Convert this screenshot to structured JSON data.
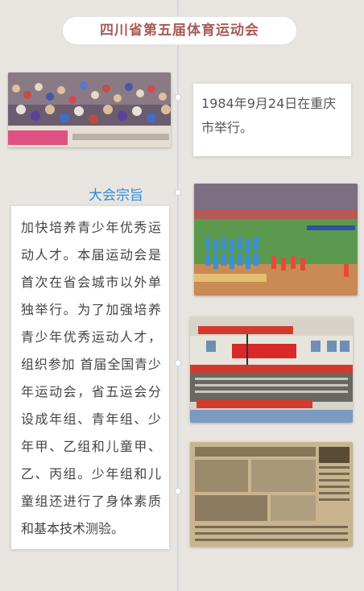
{
  "header": {
    "title": "四川省第五届体育运动会"
  },
  "timeline": {
    "date_text": "1984年9月24日在重庆市举行。",
    "section_heading": "大会宗旨",
    "description": "加快培养青少年优秀运动人才。本届运动会是首次在省会城市以外单独举行。为了加强培养青少年优秀运动人才，组织参加 首届全国青少年运动会，省五运会分设成年组、青年组、少年甲、乙组和儿童甲、乙、丙组。少年组和儿童组还进行了身体素质和基本技术测验。"
  },
  "photos": [
    {
      "name": "crowd-in-stands-photo"
    },
    {
      "name": "opening-parade-photo"
    },
    {
      "name": "stadium-grandstand-photo"
    },
    {
      "name": "newspaper-clipping-photo"
    }
  ],
  "colors": {
    "title": "#a85a57",
    "heading": "#2e8bd8",
    "background": "#e8e5e0"
  }
}
